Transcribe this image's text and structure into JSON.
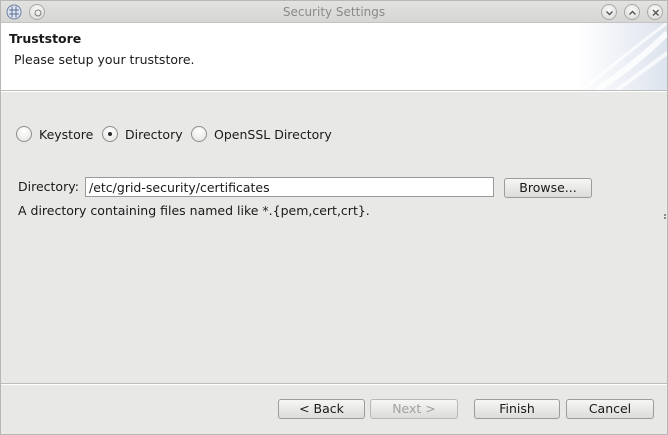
{
  "window": {
    "title": "Security Settings"
  },
  "header": {
    "title": "Truststore",
    "subtitle": "Please setup your truststore."
  },
  "store_type": {
    "options": [
      {
        "label": "Keystore",
        "checked": false
      },
      {
        "label": "Directory",
        "checked": true
      },
      {
        "label": "OpenSSL Directory",
        "checked": false
      }
    ]
  },
  "directory": {
    "label": "Directory:",
    "value": "/etc/grid-security/certificates",
    "browse_label": "Browse...",
    "hint": "A directory containing files named like *.{pem,cert,crt}."
  },
  "footer": {
    "back_label": "< Back",
    "next_label": "Next >",
    "finish_label": "Finish",
    "cancel_label": "Cancel",
    "next_enabled": false
  },
  "icons": {
    "app": "grid-app-icon",
    "titlebar": [
      "menu-icon",
      "minimize-icon",
      "maximize-icon",
      "close-icon"
    ]
  }
}
